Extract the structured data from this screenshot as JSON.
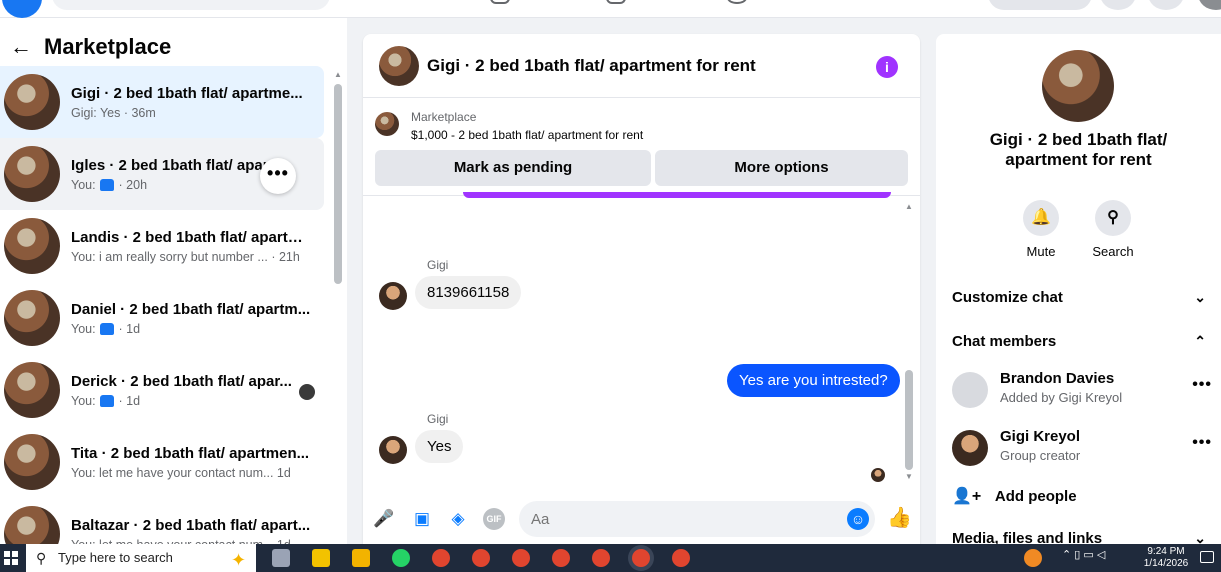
{
  "sidebar": {
    "title": "Marketplace",
    "conversations": [
      {
        "title": "Gigi · 2 bed 1bath flat/ apartme...",
        "preview": "Gigi: Yes · 36m"
      },
      {
        "title": "Igles · 2 bed 1bath flat/ apart...",
        "preview_prefix": "You:",
        "preview_suffix": "· 20h"
      },
      {
        "title": "Landis · 2 bed 1bath flat/ apartm...",
        "preview": "You: i am really sorry but number ... · 21h"
      },
      {
        "title": "Daniel · 2 bed 1bath flat/ apartm...",
        "preview_prefix": "You:",
        "preview_suffix": "· 1d"
      },
      {
        "title": "Derick · 2 bed 1bath flat/ apar...",
        "preview_prefix": "You:",
        "preview_suffix": "· 1d"
      },
      {
        "title": "Tita · 2 bed 1bath flat/ apartmen...",
        "preview": "You: let me have your contact num... 1d"
      },
      {
        "title": "Baltazar · 2 bed 1bath flat/ apart...",
        "preview": "You: let me have your contact num... 1d"
      }
    ],
    "more_label": "•••"
  },
  "chat": {
    "title": "Gigi · 2 bed 1bath flat/ apartment for rent",
    "info_label": "i",
    "listing": {
      "label": "Marketplace",
      "price_line": "$1,000 - 2 bed 1bath flat/ apartment for rent",
      "mark_pending": "Mark as pending",
      "more_options": "More options"
    },
    "messages": [
      {
        "sender": "Gigi",
        "text": "8139661158"
      },
      {
        "text": "Yes are you intrested?"
      },
      {
        "sender": "Gigi",
        "text": "Yes"
      }
    ],
    "composer": {
      "placeholder": "Aa",
      "gif_label": "GIF"
    }
  },
  "info_panel": {
    "title": "Gigi · 2 bed 1bath flat/ apartment for rent",
    "mute_label": "Mute",
    "search_label": "Search",
    "customize_label": "Customize chat",
    "members_label": "Chat members",
    "members": [
      {
        "name": "Brandon Davies",
        "sub": "Added by Gigi Kreyol"
      },
      {
        "name": "Gigi Kreyol",
        "sub": "Group creator"
      }
    ],
    "add_people_label": "Add people",
    "media_label": "Media, files and links"
  },
  "taskbar": {
    "search_placeholder": "Type here to search",
    "time": "9:24 PM",
    "date": "1/14/2026"
  },
  "colors": {
    "accent": "#0a55ff",
    "purple": "#a033ff",
    "facebook_blue": "#1877f2"
  }
}
